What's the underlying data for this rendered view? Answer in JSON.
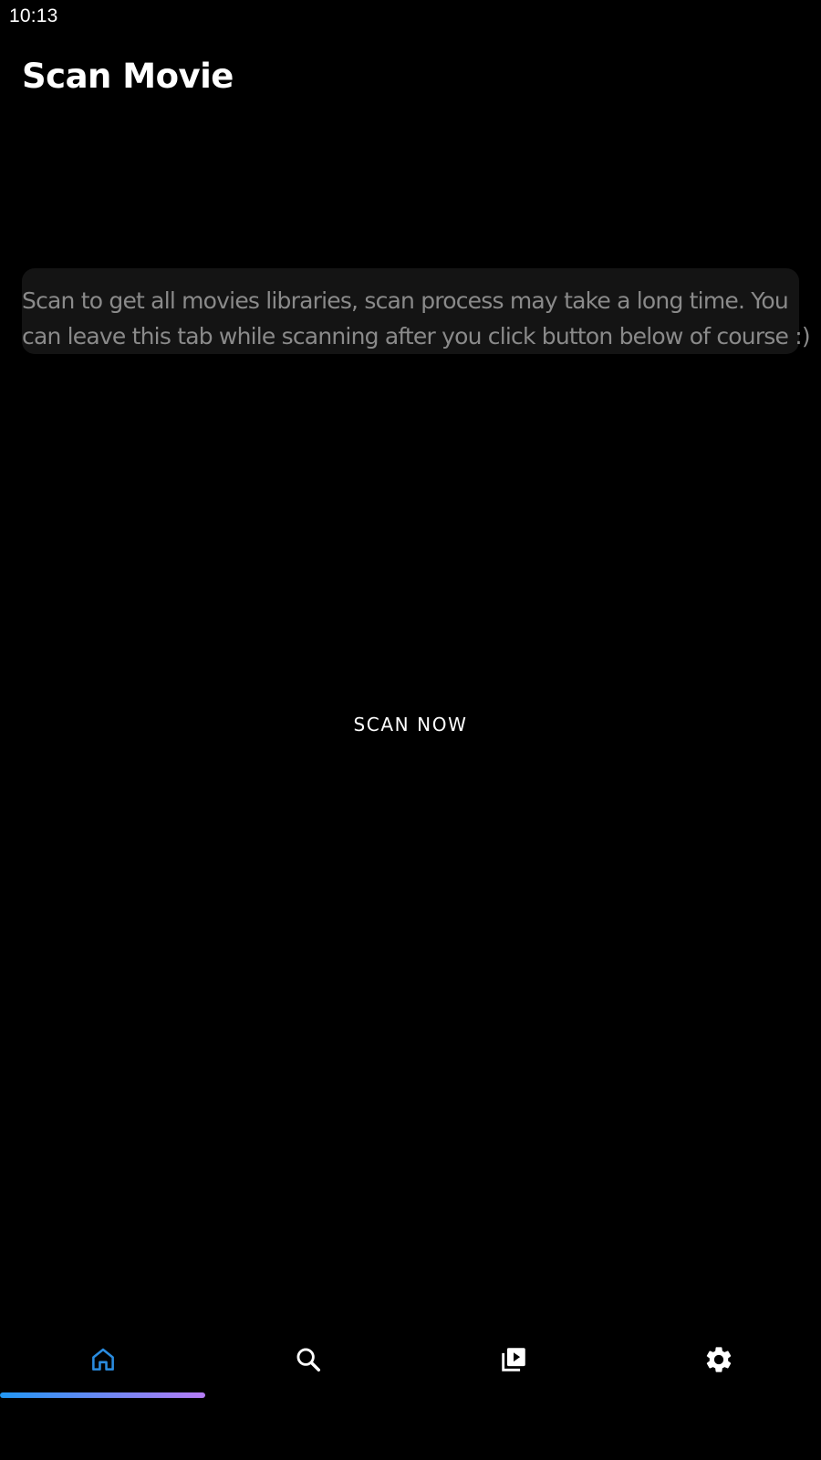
{
  "status_bar": {
    "time": "10:13"
  },
  "page": {
    "title": "Scan Movie"
  },
  "info_card": {
    "line1": "Scan to get all movies libraries, scan process may take a long time. You",
    "line2": "can leave this tab while scanning after you click button below of course :)"
  },
  "scan_button": {
    "label": "SCAN NOW"
  },
  "bottom_nav": {
    "items": [
      {
        "icon": "home-icon",
        "active": true
      },
      {
        "icon": "search-icon",
        "active": false
      },
      {
        "icon": "video-library-icon",
        "active": false
      },
      {
        "icon": "settings-gear-icon",
        "active": false
      }
    ]
  },
  "colors": {
    "background": "#000000",
    "card_background": "#141414",
    "card_text": "#8a8a8a",
    "active_icon": "#2a8ce0",
    "inactive_icon": "#ffffff",
    "indicator_gradient_start": "#2196f3",
    "indicator_gradient_end": "#b57bf5"
  }
}
